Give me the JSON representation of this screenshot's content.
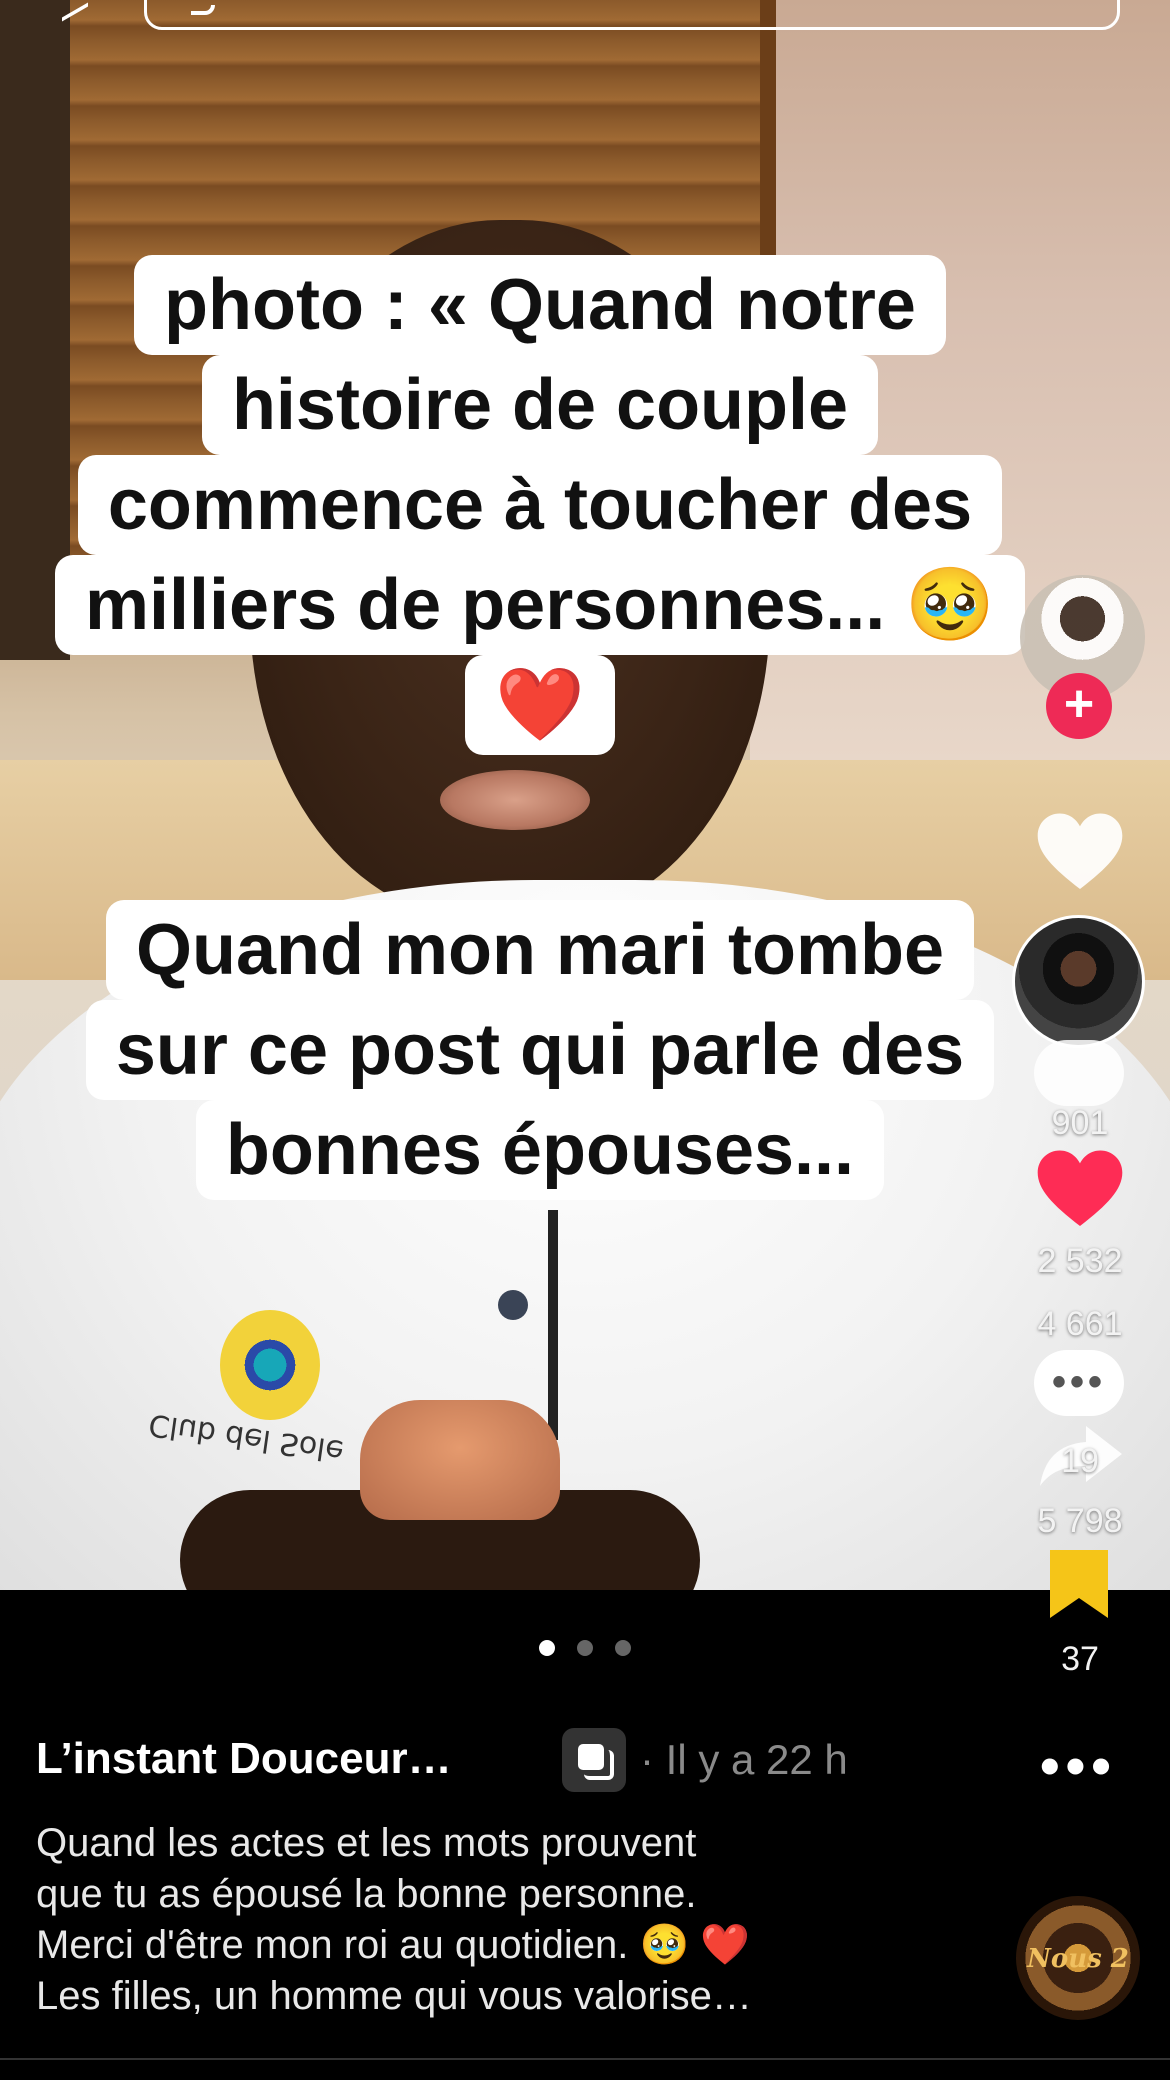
{
  "caption_top": {
    "lines": [
      "photo : « Quand notre",
      "histoire de couple",
      "commence à toucher des",
      "milliers de personnes... 🥹",
      "❤️"
    ]
  },
  "caption_bottom": {
    "lines": [
      "Quand mon mari tombe",
      "sur ce post qui parle des",
      "bonnes épouses..."
    ]
  },
  "rail": {
    "comments_count": "901",
    "likes_count": "2 532",
    "saves_count": "4 661",
    "comments2_count": "19",
    "shares_count": "5 798",
    "bookmarks_count": "37",
    "follow_symbol": "+"
  },
  "post": {
    "author": "L’instant Douceur…",
    "time": "· Il y a 22 h",
    "more_symbol": "•••",
    "description": [
      "Quand les actes et les mots prouvent",
      "que tu as épousé la bonne personne.",
      "Merci d'être mon roi au quotidien. 🥹 ❤️",
      "Les filles, un homme qui vous valorise…"
    ],
    "music_disc_text": "Nous 2"
  },
  "photo_text": {
    "shirt_logo": "Club del Sole"
  },
  "carousel": {
    "count": 3,
    "active": 0
  },
  "colors": {
    "accent_red": "#ee2a56",
    "bookmark_yellow": "#f5c518",
    "heart_red": "#fe2c55"
  },
  "icons": [
    "back-icon",
    "search-icon",
    "plus-icon",
    "heart-icon",
    "comment-icon",
    "share-icon",
    "bookmark-icon",
    "photo-mode-icon",
    "more-icon"
  ]
}
